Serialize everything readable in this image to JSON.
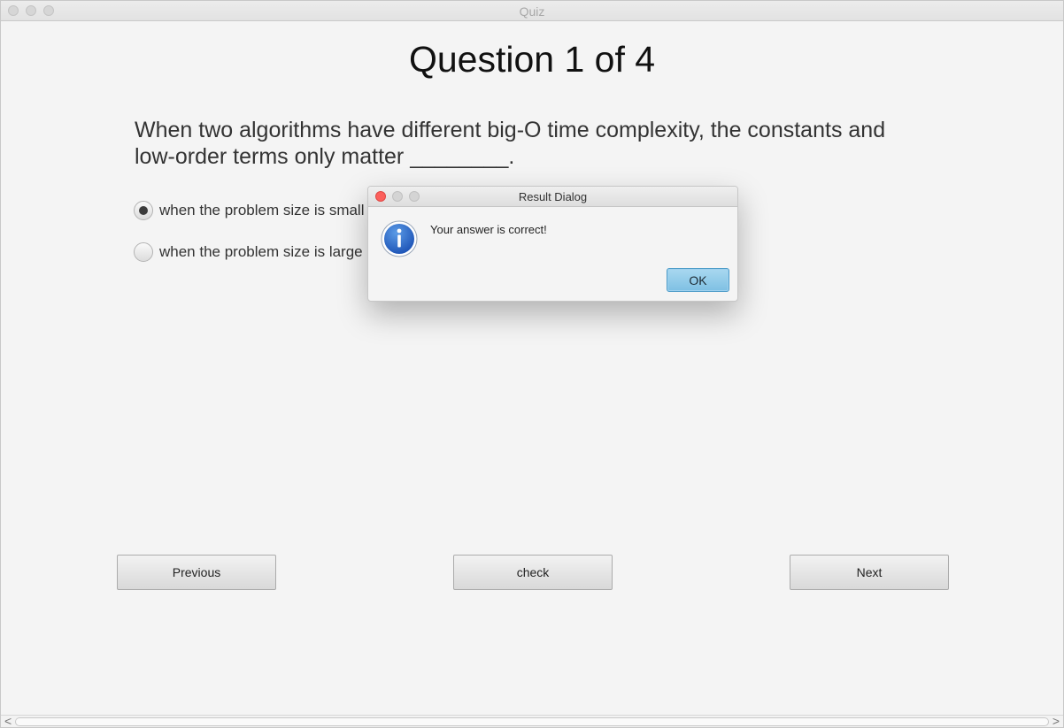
{
  "window": {
    "title": "Quiz"
  },
  "question": {
    "header": "Question 1 of 4",
    "text": "When two algorithms have different big-O time complexity, the constants and low-order terms only matter ________.",
    "options": [
      {
        "label": "when the problem size is small",
        "selected": true
      },
      {
        "label": "when the problem size is large",
        "selected": false
      }
    ]
  },
  "buttons": {
    "previous": "Previous",
    "check": "check",
    "next": "Next"
  },
  "scrollbar": {
    "left_arrow": "<",
    "right_arrow": ">"
  },
  "dialog": {
    "title": "Result Dialog",
    "message": "Your answer is correct!",
    "ok_label": "OK",
    "icon": "info-icon",
    "icon_color": "#2f6fcf"
  }
}
